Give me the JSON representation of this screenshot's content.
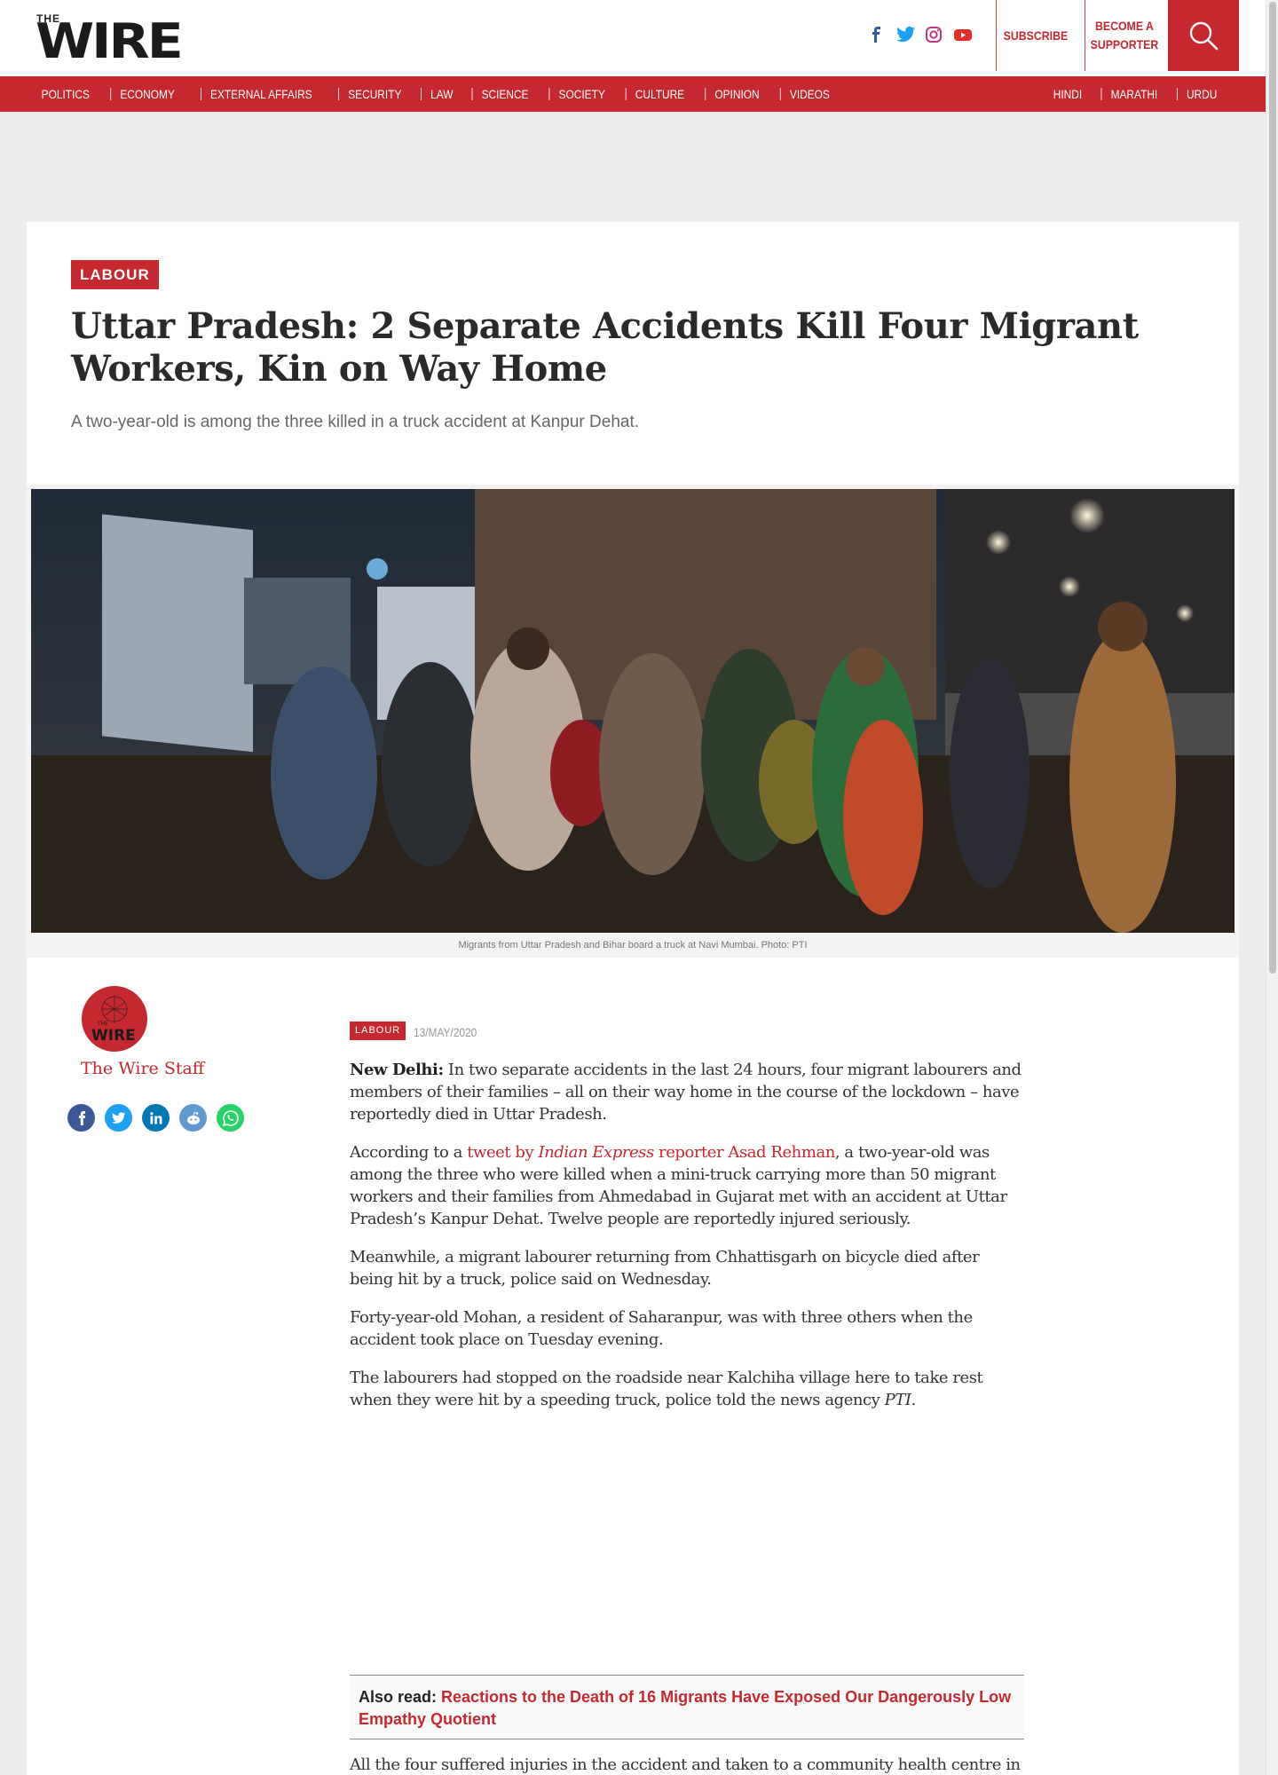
{
  "header": {
    "logo_small": "THE",
    "logo_big": "WIRE",
    "social_icons": [
      "facebook-icon",
      "twitter-icon",
      "instagram-icon",
      "youtube-icon"
    ],
    "subscribe": "SUBSCRIBE",
    "supporter_line1": "BECOME A",
    "supporter_line2": "SUPPORTER",
    "search_icon": "search-icon"
  },
  "nav": {
    "left": [
      "POLITICS",
      "ECONOMY",
      "EXTERNAL AFFAIRS",
      "SECURITY",
      "LAW",
      "SCIENCE",
      "SOCIETY",
      "CULTURE",
      "OPINION",
      "VIDEOS"
    ],
    "right": [
      "HINDI",
      "MARATHI",
      "URDU"
    ]
  },
  "article": {
    "category": "LABOUR",
    "title": "Uttar Pradesh: 2 Separate Accidents Kill Four Migrant Workers, Kin on Way Home",
    "dek": "A two-year-old is among the three killed in a truck accident at Kanpur Dehat.",
    "caption": "Migrants from Uttar Pradesh and Bihar board a truck at Navi Mumbai. Photo: PTI",
    "author": "The Wire Staff",
    "author_avatar_text": "THE WIRE",
    "share_icons": [
      "facebook-icon",
      "twitter-icon",
      "linkedin-icon",
      "reddit-icon",
      "whatsapp-icon"
    ],
    "small_category": "LABOUR",
    "date": "13/MAY/2020",
    "p1_lead": "New Delhi:",
    "p1": " In two separate accidents in the last 24 hours, four migrant labourers and members of their families – all on their way home in the course of the lockdown – have reportedly died in Uttar Pradesh.",
    "p2_a": "According to a ",
    "p2_link_a": "tweet by ",
    "p2_link_em": "Indian Express",
    "p2_link_b": " reporter Asad Rehman",
    "p2_b": ", a two-year-old was among the three who were killed when a mini-truck carrying more than 50 migrant workers and their families from Ahmedabad in Gujarat met with an accident at Uttar Pradesh’s Kanpur Dehat. Twelve people are reportedly injured seriously.",
    "p3": "Meanwhile, a migrant labourer returning from Chhattisgarh on bicycle died after being hit by a truck, police said on Wednesday.",
    "p4": "Forty-year-old Mohan, a resident of Saharanpur, was with three others when the accident took place on Tuesday evening.",
    "p5_a": "The labourers had stopped on the roadside near Kalchiha village here to take rest when they were hit by a speeding truck, police told the news agency ",
    "p5_em": "PTI",
    "p5_b": ".",
    "also_label": "Also read: ",
    "also_link": "Reactions to the Death of 16 Migrants Have Exposed Our Dangerously Low Empathy Quotient",
    "cut_text": "All the four suffered injuries in the accident and taken to a community health centre in"
  },
  "colors": {
    "brand_red": "#c5282f",
    "page_bg": "#ececec"
  }
}
